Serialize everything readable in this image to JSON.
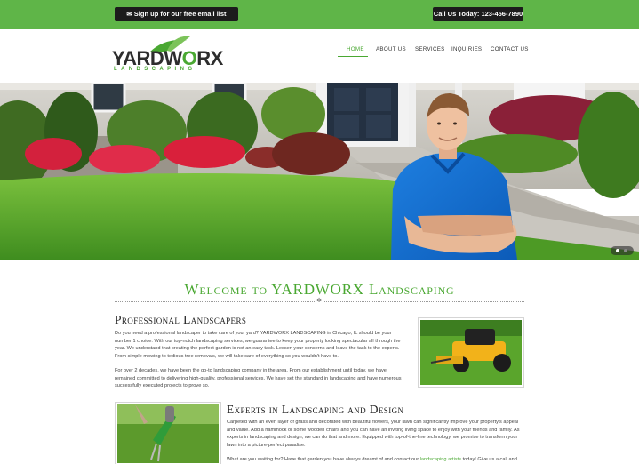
{
  "topbar": {
    "signup_label": "✉ Sign up for our free email list",
    "call_label": "Call Us Today: 123-456-7890"
  },
  "logo": {
    "main_dark_1": "YARDW",
    "main_green": "O",
    "main_dark_2": "RX",
    "sub": "LANDSCAPING"
  },
  "nav": {
    "items": [
      {
        "label": "HOME"
      },
      {
        "label": "ABOUT US"
      },
      {
        "label": "SERVICES"
      },
      {
        "label": "INQUIRIES"
      },
      {
        "label": "CONTACT US"
      }
    ]
  },
  "welcome": {
    "title": "Welcome to YARDWORX Landscaping"
  },
  "section1": {
    "heading": "Professional Landscapers",
    "paragraph1": "Do you need a professional landscaper to take care of your yard? YARDWORX LANDSCAPING in Chicago, IL should be your number 1 choice. With our top-notch landscaping services, we guarantee to keep your property looking spectacular all through the year. We understand that creating the perfect garden is not an easy task. Lessen your concerns and leave the task to the experts. From simple mowing to tedious tree removals, we will take care of everything so you wouldn't have to.",
    "paragraph2": "For over 2 decades, we have been the go-to landscaping company in the area. From our establishment until today, we have remained committed to delivering high-quality, professional services. We have set the standard in landscaping and have numerous successfully executed projects to prove so."
  },
  "section2": {
    "heading": "Experts in Landscaping and Design",
    "paragraph1": "Carpeted with an even layer of grass and decorated with beautiful flowers, your lawn can significantly improve your property's appeal and value. Add a hammock or some wooden chairs and you can have an inviting living space to enjoy with your friends and family. As experts in landscaping and design, we can do that and more. Equipped with top-of-the-line technology, we promise to transform your lawn into a picture-perfect paradise.",
    "paragraph2_before": "What are you waiting for? Have that garden you have always dreamt of and contact our ",
    "paragraph2_link": "landscaping artists",
    "paragraph2_after": " today! Give us a call and"
  },
  "colors": {
    "brand_green": "#5fb548",
    "dark": "#1c1c1c"
  }
}
